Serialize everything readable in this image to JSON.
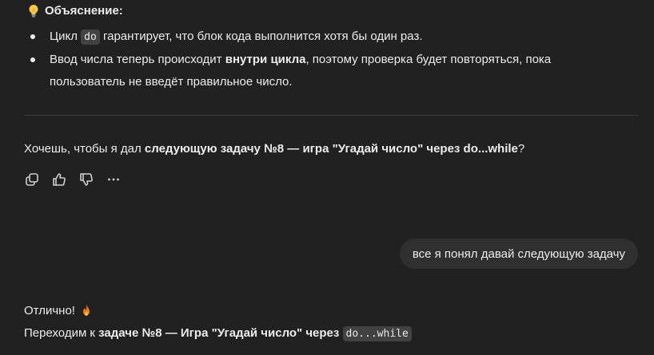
{
  "explanation": {
    "heading": "Объяснение:",
    "points": [
      {
        "before": "Цикл ",
        "code": "do",
        "after": " гарантирует, что блок кода выполнится хотя бы один раз."
      },
      {
        "before": "Ввод числа теперь происходит ",
        "bold": "внутри цикла",
        "after": ", поэтому проверка будет повторяться, пока пользователь не введёт правильное число."
      }
    ]
  },
  "question": {
    "before": "Хочешь, чтобы я дал ",
    "bold": "следующую задачу №8 — игра \"Угадай число\" через do...while",
    "after": "?"
  },
  "actions": {
    "icons": [
      "copy-icon",
      "thumbs-up-icon",
      "thumbs-down-icon",
      "more-icon"
    ]
  },
  "user_message": "все я понял давай следующую задачу",
  "reply": {
    "line1": "Отлично!",
    "line2_before": "Переходим к ",
    "line2_bold": "задаче №8 — Игра \"Угадай число\" через",
    "line2_code": "do...while"
  },
  "colors": {
    "background": "#212121",
    "text": "#ececec",
    "bubble": "#303030",
    "code_bg": "#424242"
  }
}
